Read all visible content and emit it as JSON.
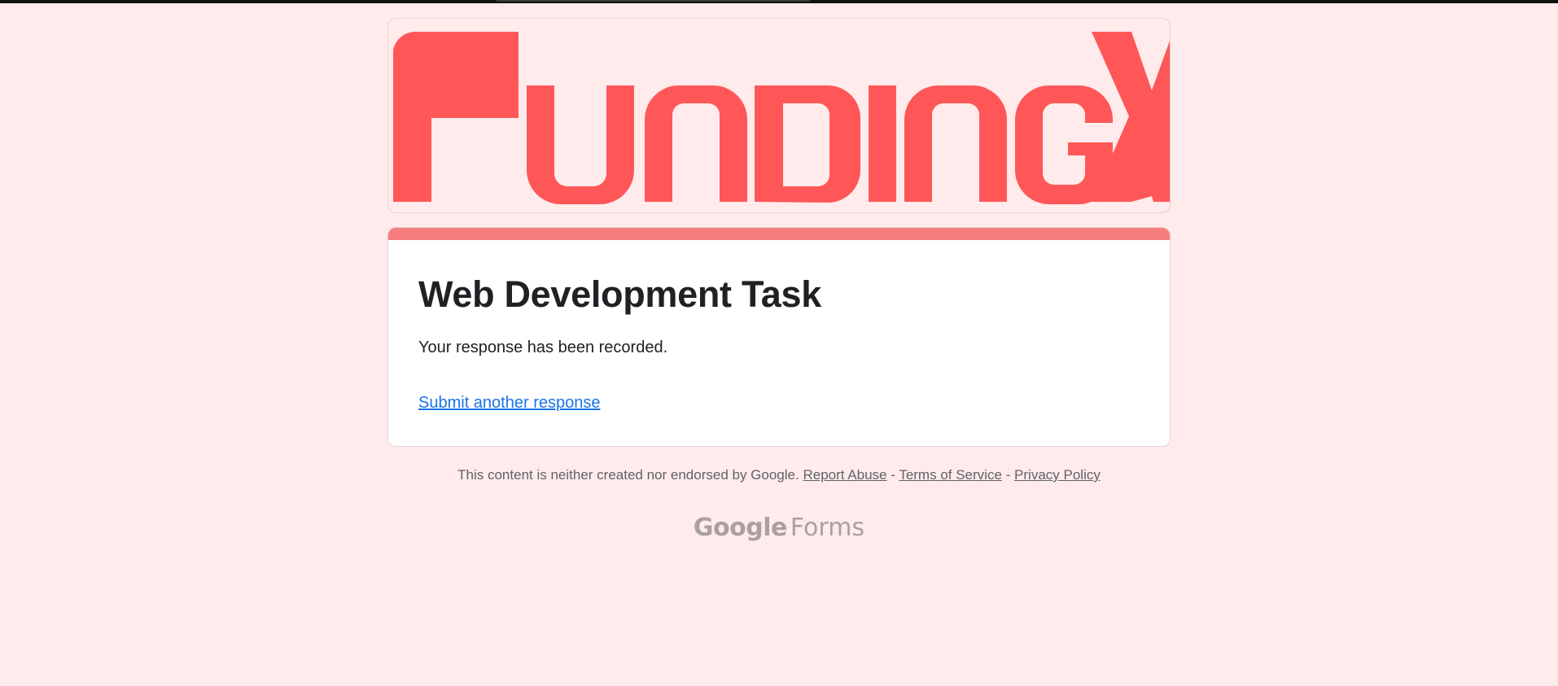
{
  "header": {
    "logo_text": "FundingX",
    "logo_color": "#ff5757"
  },
  "theme": {
    "page_bg": "#ffebeb",
    "accent": "#f77e7e",
    "link": "#1a73e8"
  },
  "form": {
    "title": "Web Development Task",
    "confirmation": "Your response has been recorded.",
    "submit_another": "Submit another response"
  },
  "footer": {
    "disclaimer": "This content is neither created nor endorsed by Google.",
    "report_abuse": "Report Abuse",
    "separator": "-",
    "terms": "Terms of Service",
    "privacy": "Privacy Policy"
  },
  "branding": {
    "google": "Google",
    "forms": "Forms"
  }
}
